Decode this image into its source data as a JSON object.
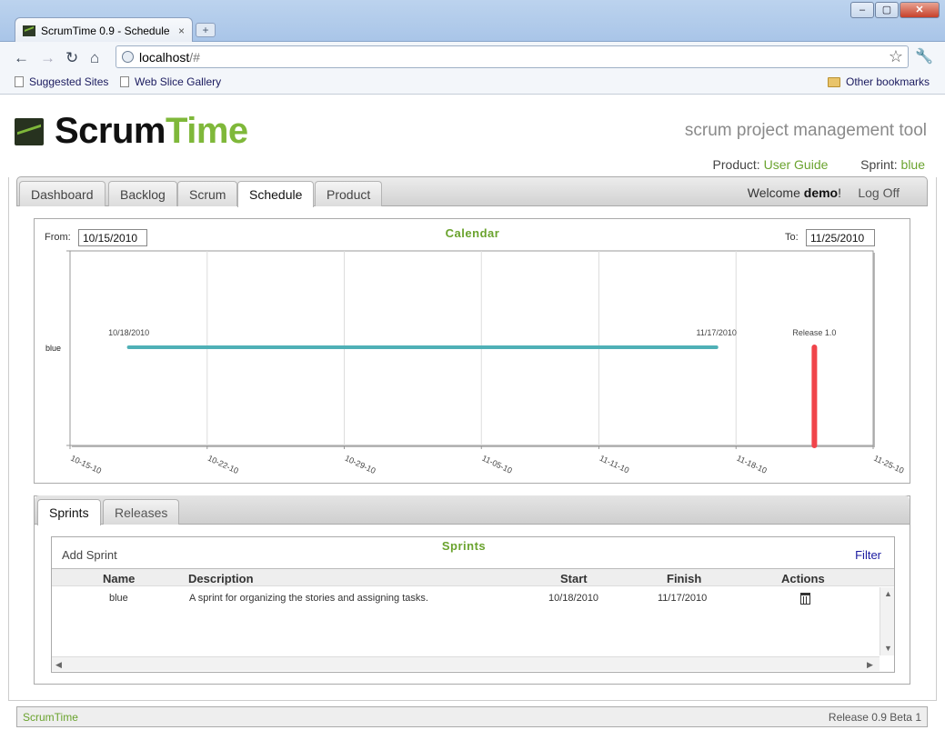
{
  "browser": {
    "tab_title": "ScrumTime 0.9 - Schedule",
    "tab_close": "×",
    "new_tab": "+",
    "url_host": "localhost",
    "url_path": "/#",
    "bookmarks": [
      "Suggested Sites",
      "Web Slice Gallery"
    ],
    "other_bookmarks": "Other bookmarks",
    "window_buttons": [
      "–",
      "▢",
      "✕"
    ],
    "nav_icons": [
      "back-arrow-icon",
      "forward-arrow-icon",
      "reload-icon",
      "home-icon"
    ]
  },
  "app": {
    "logo_scrum": "Scrum",
    "logo_time": "Time",
    "tagline": "scrum project management tool",
    "product_label": "Product:",
    "product_value": "User Guide",
    "sprint_label": "Sprint:",
    "sprint_value": "blue"
  },
  "nav": {
    "tabs": [
      "Dashboard",
      "Backlog",
      "Scrum",
      "Schedule",
      "Product"
    ],
    "active": "Schedule",
    "welcome_prefix": "Welcome",
    "user": "demo",
    "welcome_suffix": "!",
    "logoff": "Log Off"
  },
  "calendar": {
    "title": "Calendar",
    "from_label": "From:",
    "from_value": "10/15/2010",
    "to_label": "To:",
    "to_value": "11/25/2010"
  },
  "chart_data": {
    "type": "timeline",
    "xlim": [
      "10-15-10",
      "11-25-10"
    ],
    "x_ticks": [
      "10-15-10",
      "10-22-10",
      "10-29-10",
      "11-05-10",
      "11-11-10",
      "11-18-10",
      "11-25-10"
    ],
    "grid": true,
    "rows": [
      "blue"
    ],
    "sprints": [
      {
        "name": "blue",
        "start": "10/18/2010",
        "finish": "11/17/2010",
        "start_label": "10/18/2010",
        "finish_label": "11/17/2010",
        "color": "#4fb0b6"
      }
    ],
    "releases": [
      {
        "name": "Release 1.0",
        "date": "11-22-10",
        "color": "#f0444a"
      }
    ]
  },
  "subnav": {
    "tabs": [
      "Sprints",
      "Releases"
    ],
    "active": "Sprints"
  },
  "sprints": {
    "title": "Sprints",
    "add": "Add Sprint",
    "filter": "Filter",
    "columns": [
      "Name",
      "Description",
      "Start",
      "Finish",
      "Actions"
    ],
    "rows": [
      {
        "name": "blue",
        "description": "A sprint for organizing the stories and assigning tasks.",
        "start": "10/18/2010",
        "finish": "11/17/2010",
        "action_icon": "trash-icon"
      }
    ]
  },
  "footer": {
    "left": "ScrumTime",
    "right": "Release 0.9 Beta 1"
  },
  "colors": {
    "brand_green": "#7fb83a",
    "link_green": "#6aa32e",
    "sprint_bar": "#4fb0b6",
    "release_bar": "#f0444a"
  }
}
